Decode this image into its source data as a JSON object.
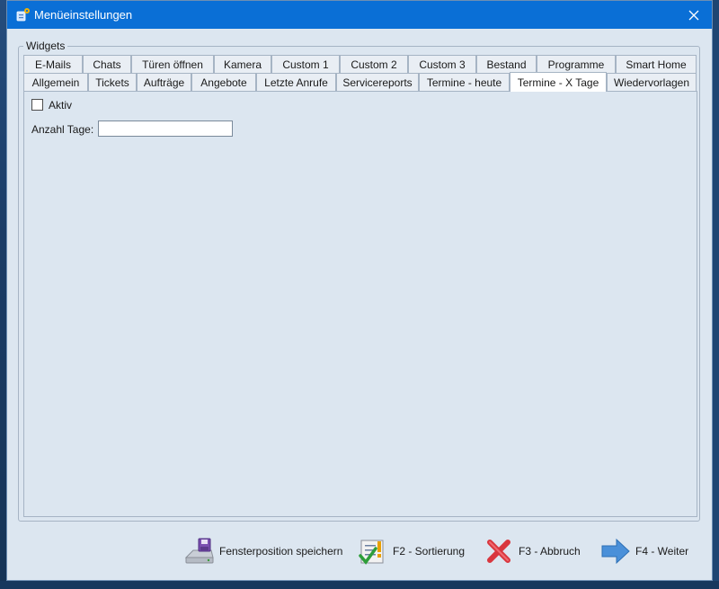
{
  "window": {
    "title": "Menüeinstellungen"
  },
  "groupbox": {
    "label": "Widgets"
  },
  "tabs_top": [
    {
      "label": "E-Mails"
    },
    {
      "label": "Chats"
    },
    {
      "label": "Türen öffnen"
    },
    {
      "label": "Kamera"
    },
    {
      "label": "Custom 1"
    },
    {
      "label": "Custom 2"
    },
    {
      "label": "Custom 3"
    },
    {
      "label": "Bestand"
    },
    {
      "label": "Programme"
    },
    {
      "label": "Smart Home"
    }
  ],
  "tabs_bottom": [
    {
      "label": "Allgemein"
    },
    {
      "label": "Tickets"
    },
    {
      "label": "Aufträge"
    },
    {
      "label": "Angebote"
    },
    {
      "label": "Letzte Anrufe"
    },
    {
      "label": "Servicereports"
    },
    {
      "label": "Termine - heute"
    },
    {
      "label": "Termine - X Tage"
    },
    {
      "label": "Wiedervorlagen"
    }
  ],
  "active_tab": "Termine - X Tage",
  "panel": {
    "aktiv_label": "Aktiv",
    "aktiv_checked": false,
    "anzahl_label": "Anzahl Tage:",
    "anzahl_value": ""
  },
  "footer": {
    "save_position": "Fensterposition speichern",
    "sort": "F2 - Sortierung",
    "cancel": "F3 - Abbruch",
    "next": "F4 - Weiter"
  },
  "colors": {
    "titlebar": "#0a6fd6",
    "window_bg": "#dce6f0",
    "active_tab": "#ffffff",
    "cancel_red": "#d9363e",
    "next_blue": "#4a90d9"
  },
  "icons": {
    "app": "app-settings-icon",
    "close": "close-icon",
    "save": "save-disk-icon",
    "sort": "checklist-icon",
    "cancel": "red-x-icon",
    "next": "arrow-right-icon"
  }
}
